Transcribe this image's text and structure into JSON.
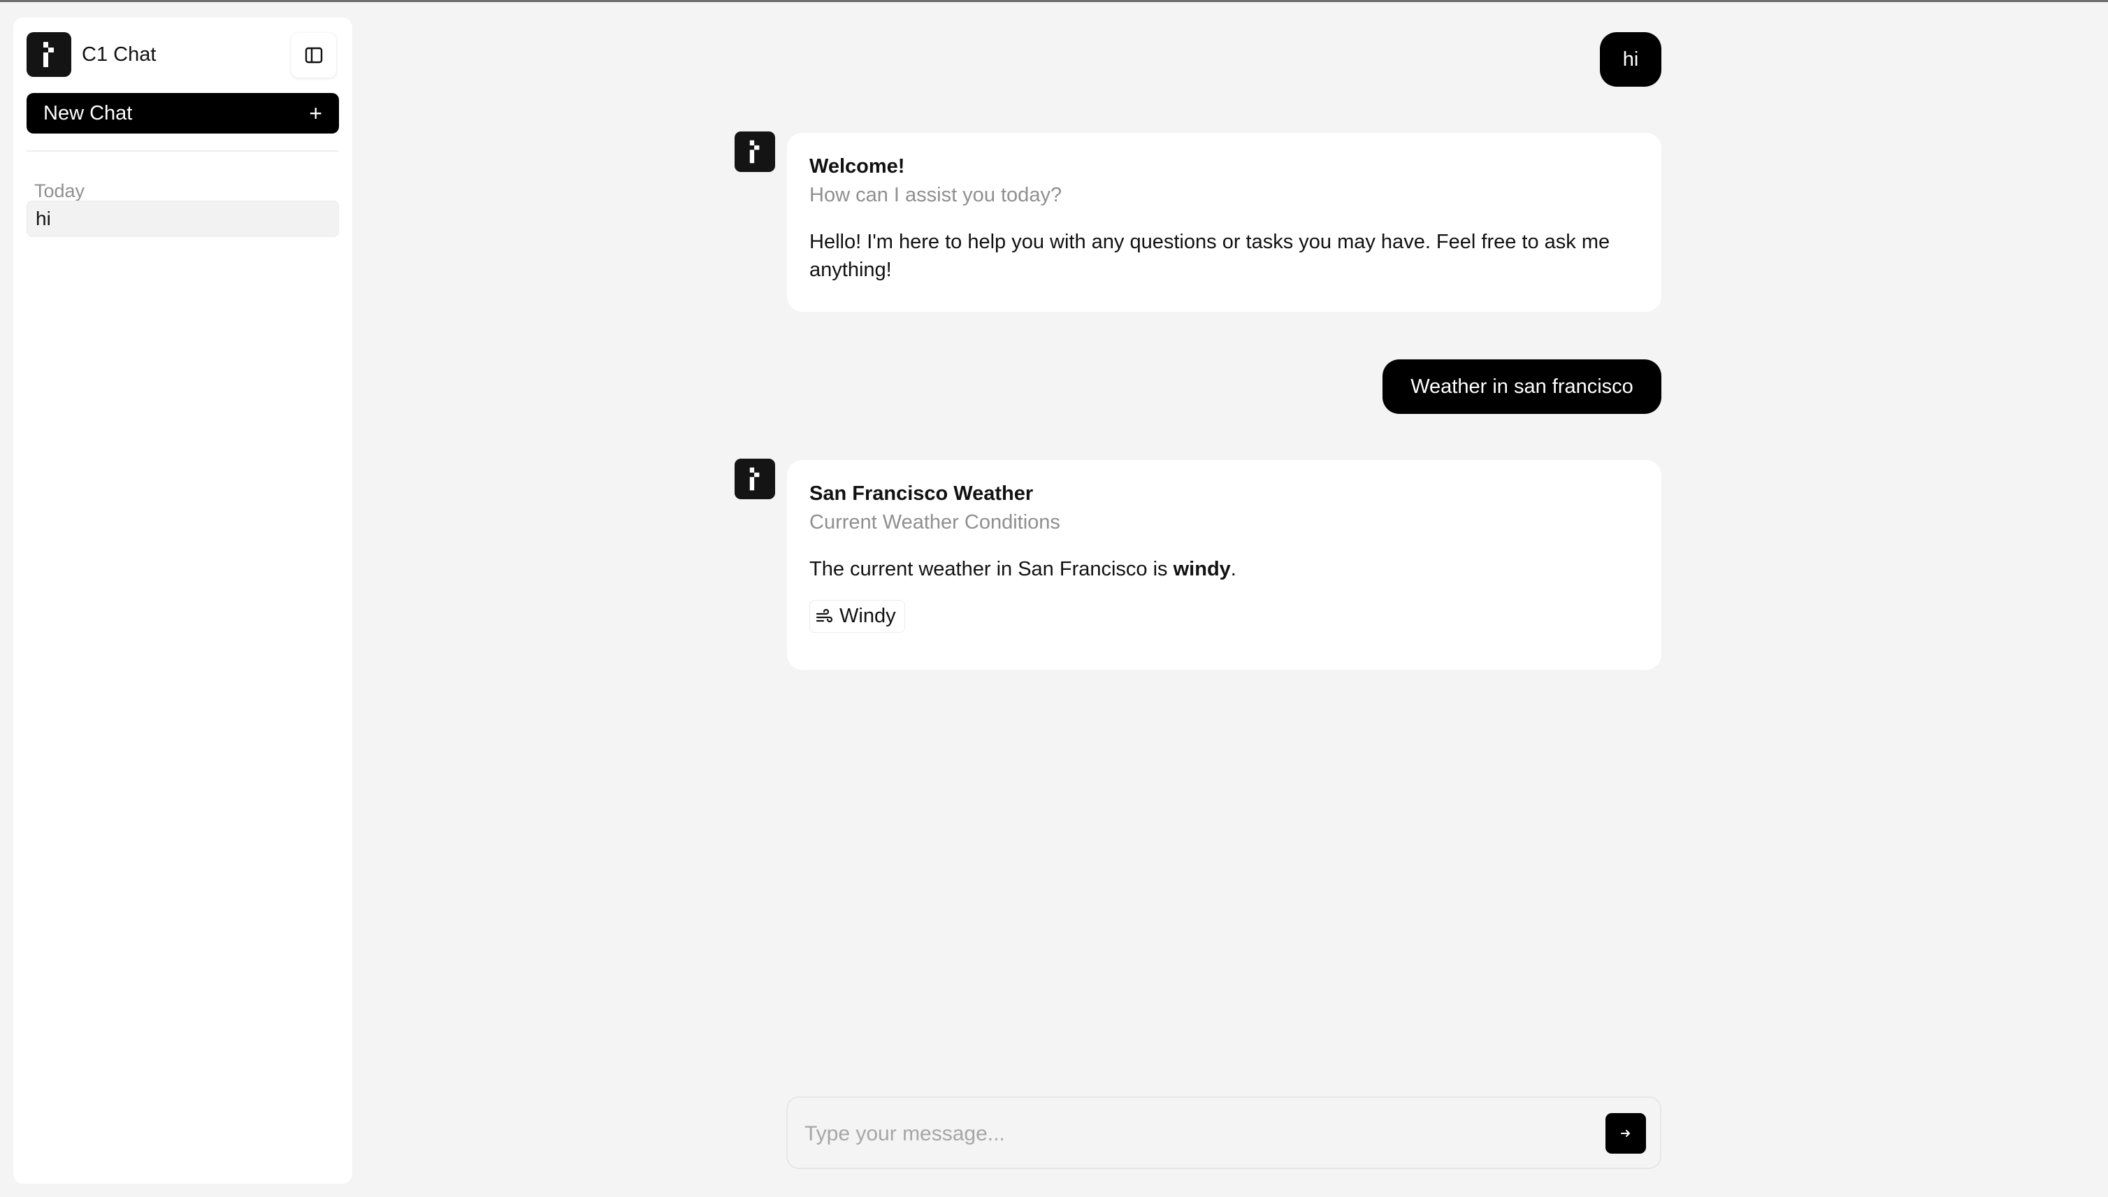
{
  "sidebar": {
    "brand_title": "C1 Chat",
    "new_chat_label": "New Chat",
    "new_chat_icon": "+",
    "section_today": "Today",
    "history": [
      {
        "label": "hi"
      }
    ]
  },
  "messages": {
    "user_1": "hi",
    "assistant_1": {
      "title": "Welcome!",
      "subtitle": "How can I assist you today?",
      "body": "Hello! I'm here to help you with any questions or tasks you may have. Feel free to ask me anything!"
    },
    "user_2": "Weather in san francisco",
    "assistant_2": {
      "title": "San Francisco Weather",
      "subtitle": "Current Weather Conditions",
      "body_prefix": "The current weather in San Francisco is ",
      "body_bold": "windy",
      "body_suffix": ".",
      "chip_label": "Windy",
      "chip_icon": "wind-icon"
    }
  },
  "composer": {
    "placeholder": "Type your message..."
  },
  "colors": {
    "background": "#f4f4f4",
    "accent": "#000000",
    "muted_text": "#8f8f8f"
  }
}
